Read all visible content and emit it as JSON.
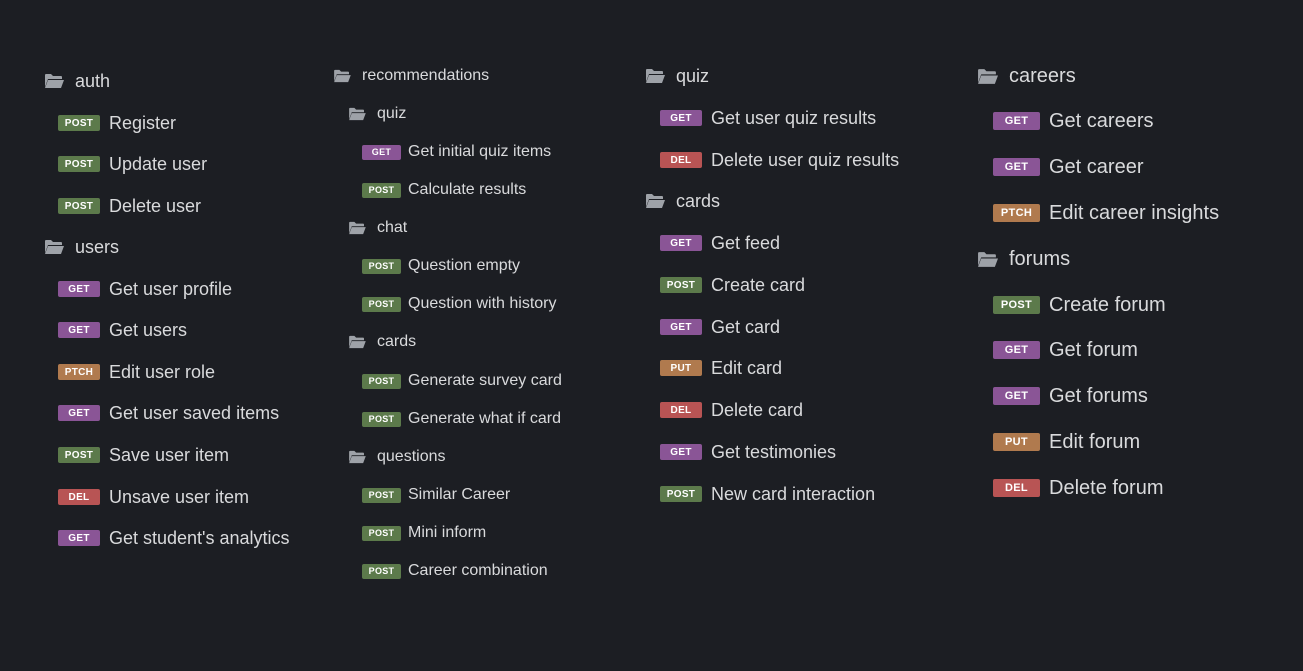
{
  "colors": {
    "background": "#1c1e23",
    "text": "#d9dadc",
    "POST": "#5c7a4b",
    "GET": "#8a5596",
    "DEL": "#b85454",
    "PUT": "#b07a4e",
    "PTCH": "#b07a4e"
  },
  "columns": [
    {
      "items": [
        {
          "type": "folder",
          "label": "auth"
        },
        {
          "type": "request",
          "method": "POST",
          "label": "Register"
        },
        {
          "type": "request",
          "method": "POST",
          "label": "Update user"
        },
        {
          "type": "request",
          "method": "POST",
          "label": "Delete user"
        },
        {
          "type": "folder",
          "label": "users"
        },
        {
          "type": "request",
          "method": "GET",
          "label": "Get user profile"
        },
        {
          "type": "request",
          "method": "GET",
          "label": "Get users"
        },
        {
          "type": "request",
          "method": "PTCH",
          "label": "Edit user role"
        },
        {
          "type": "request",
          "method": "GET",
          "label": "Get user saved items"
        },
        {
          "type": "request",
          "method": "POST",
          "label": "Save user item"
        },
        {
          "type": "request",
          "method": "DEL",
          "label": "Unsave user item"
        },
        {
          "type": "request",
          "method": "GET",
          "label": "Get student's analytics"
        }
      ]
    },
    {
      "items": [
        {
          "type": "folder",
          "label": "recommendations"
        },
        {
          "type": "folder",
          "label": "quiz"
        },
        {
          "type": "request",
          "method": "GET",
          "label": "Get initial quiz items"
        },
        {
          "type": "request",
          "method": "POST",
          "label": "Calculate results"
        },
        {
          "type": "folder",
          "label": "chat"
        },
        {
          "type": "request",
          "method": "POST",
          "label": "Question empty"
        },
        {
          "type": "request",
          "method": "POST",
          "label": "Question with history"
        },
        {
          "type": "folder",
          "label": "cards"
        },
        {
          "type": "request",
          "method": "POST",
          "label": "Generate survey card"
        },
        {
          "type": "request",
          "method": "POST",
          "label": "Generate what if card"
        },
        {
          "type": "folder",
          "label": "questions"
        },
        {
          "type": "request",
          "method": "POST",
          "label": "Similar Career"
        },
        {
          "type": "request",
          "method": "POST",
          "label": "Mini inform"
        },
        {
          "type": "request",
          "method": "POST",
          "label": "Career combination"
        }
      ]
    },
    {
      "items": [
        {
          "type": "folder",
          "label": "quiz"
        },
        {
          "type": "request",
          "method": "GET",
          "label": "Get user quiz results"
        },
        {
          "type": "request",
          "method": "DEL",
          "label": "Delete user quiz results"
        },
        {
          "type": "folder",
          "label": "cards"
        },
        {
          "type": "request",
          "method": "GET",
          "label": "Get feed"
        },
        {
          "type": "request",
          "method": "POST",
          "label": "Create card"
        },
        {
          "type": "request",
          "method": "GET",
          "label": "Get card"
        },
        {
          "type": "request",
          "method": "PUT",
          "label": "Edit card"
        },
        {
          "type": "request",
          "method": "DEL",
          "label": "Delete card"
        },
        {
          "type": "request",
          "method": "GET",
          "label": "Get testimonies"
        },
        {
          "type": "request",
          "method": "POST",
          "label": "New card interaction"
        }
      ]
    },
    {
      "items": [
        {
          "type": "folder",
          "label": "careers"
        },
        {
          "type": "request",
          "method": "GET",
          "label": "Get careers"
        },
        {
          "type": "request",
          "method": "GET",
          "label": "Get career"
        },
        {
          "type": "request",
          "method": "PTCH",
          "label": "Edit career insights"
        },
        {
          "type": "folder",
          "label": "forums"
        },
        {
          "type": "request",
          "method": "POST",
          "label": "Create forum"
        },
        {
          "type": "request",
          "method": "GET",
          "label": "Get forum"
        },
        {
          "type": "request",
          "method": "GET",
          "label": "Get forums"
        },
        {
          "type": "request",
          "method": "PUT",
          "label": "Edit forum"
        },
        {
          "type": "request",
          "method": "DEL",
          "label": "Delete forum"
        }
      ]
    }
  ]
}
